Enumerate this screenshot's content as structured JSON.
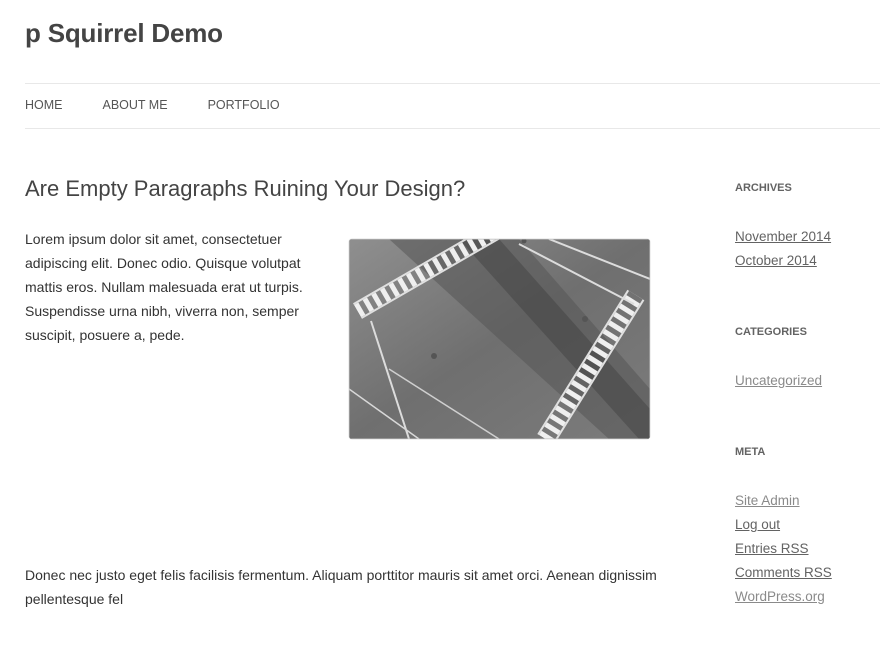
{
  "site": {
    "title": "p Squirrel Demo"
  },
  "nav": {
    "items": [
      "HOME",
      "ABOUT ME",
      "PORTFOLIO"
    ]
  },
  "post": {
    "title": "Are Empty Paragraphs Ruining Your Design?",
    "paragraph1": "Lorem ipsum dolor sit amet, consectetuer adipiscing elit. Donec odio. Quisque volutpat mattis eros. Nullam malesuada erat ut turpis. Suspendisse urna nibh, viverra non, semper suscipit, posuere a, pede.",
    "paragraph2": "Donec nec justo eget felis facilisis fermentum. Aliquam porttitor mauris sit amet orci. Aenean dignissim pellentesque fel"
  },
  "sidebar": {
    "archives": {
      "title": "ARCHIVES",
      "items": [
        "November 2014",
        "October 2014"
      ]
    },
    "categories": {
      "title": "CATEGORIES",
      "items": [
        "Uncategorized"
      ]
    },
    "meta": {
      "title": "META",
      "items": [
        "Site Admin",
        "Log out",
        "Entries RSS",
        "Comments RSS",
        "WordPress.org"
      ]
    }
  }
}
